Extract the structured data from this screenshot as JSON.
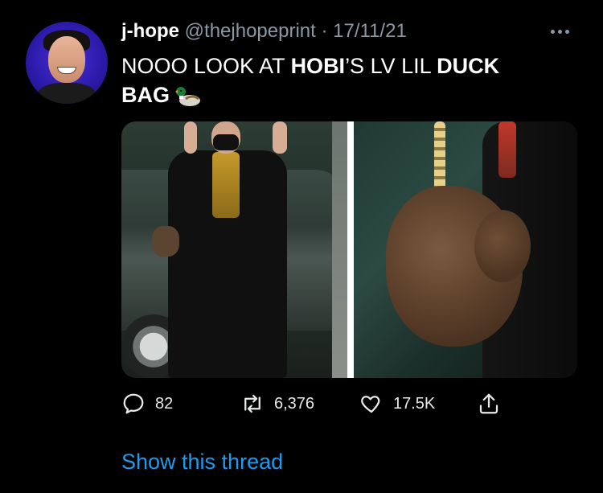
{
  "author": {
    "name": "j-hope",
    "handle": "@thejhopeprint",
    "separator": "·",
    "date": "17/11/21"
  },
  "tweet_text": {
    "part1": "NOOO LOOK AT ",
    "bold1": "HOBI",
    "part2": "’S LV LIL ",
    "bold2": "DUCK",
    "bold3": "BAG",
    "emoji": "duck-emoji-icon"
  },
  "actions": {
    "replies": "82",
    "retweets": "6,376",
    "likes": "17.5K"
  },
  "show_thread_label": "Show this thread",
  "colors": {
    "background": "#000000",
    "text": "#e7e9ea",
    "muted": "#8b98a5",
    "link": "#1d9bf0"
  }
}
